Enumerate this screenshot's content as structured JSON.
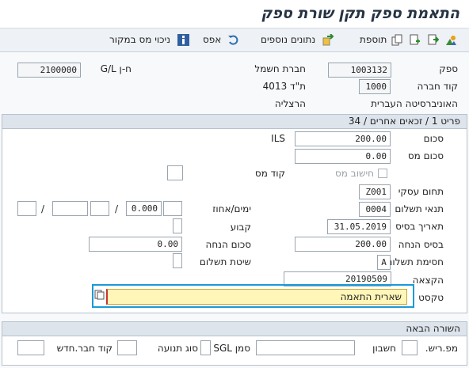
{
  "title": "התאמת ספק תקן שורת ספק",
  "toolbar": {
    "additions": "תוספת",
    "more_data": "נתונים נוספים",
    "zero": "אפס",
    "withholding": "ניכוי מס במקור"
  },
  "header": {
    "vendor_label": "ספק",
    "vendor_value": "1003132",
    "company_code_label": "קוד חברה",
    "company_code_value": "1000",
    "gl_label": "ח-ן G/L",
    "gl_value": "2100000",
    "company_name_label": "חברת חשמל",
    "po_box": "ת\"ד 4013",
    "university": "האוניברסיטה העברית",
    "city": "הרצליה"
  },
  "item": {
    "section_title": "פריט 1 / זכאים אחרים / 34",
    "amount_label": "סכום",
    "amount_value": "200.00",
    "currency": "ILS",
    "tax_amount_label": "סכום מס",
    "tax_amount_value": "0.00",
    "calc_tax_label": "חישוב מס",
    "tax_code_label": "קוד מס",
    "business_area_label": "תחום עסקי",
    "business_area_value": "Z001",
    "payment_terms_label": "תנאי תשלום",
    "payment_terms_value": "0004",
    "days_percent_label": "ימים/אחוז",
    "days_percent_value": "0.000",
    "base_date_label": "תאריך בסיס",
    "base_date_value": "31.05.2019",
    "fixed_label": "קבוע",
    "discount_base_label": "בסיס הנחה",
    "discount_base_value": "200.00",
    "discount_amount_label": "סכום הנחה",
    "discount_amount_value": "0.00",
    "payment_block_label": "חסימת תשלום",
    "payment_block_value": "A",
    "payment_method_label": "שיטת תשלום",
    "assignment_label": "הקצאה",
    "assignment_value": "20190509",
    "text_label": "טקסט",
    "text_value": "שארית התאמה"
  },
  "next_line": {
    "section_title": "השורה הבאה",
    "posting_key_label": "מפ.ריש.",
    "account_label": "חשבון",
    "sgl_label": "סמן SGL",
    "trans_type_label": "סוג תנועה",
    "new_company_label": "קוד חבר.חדש"
  }
}
